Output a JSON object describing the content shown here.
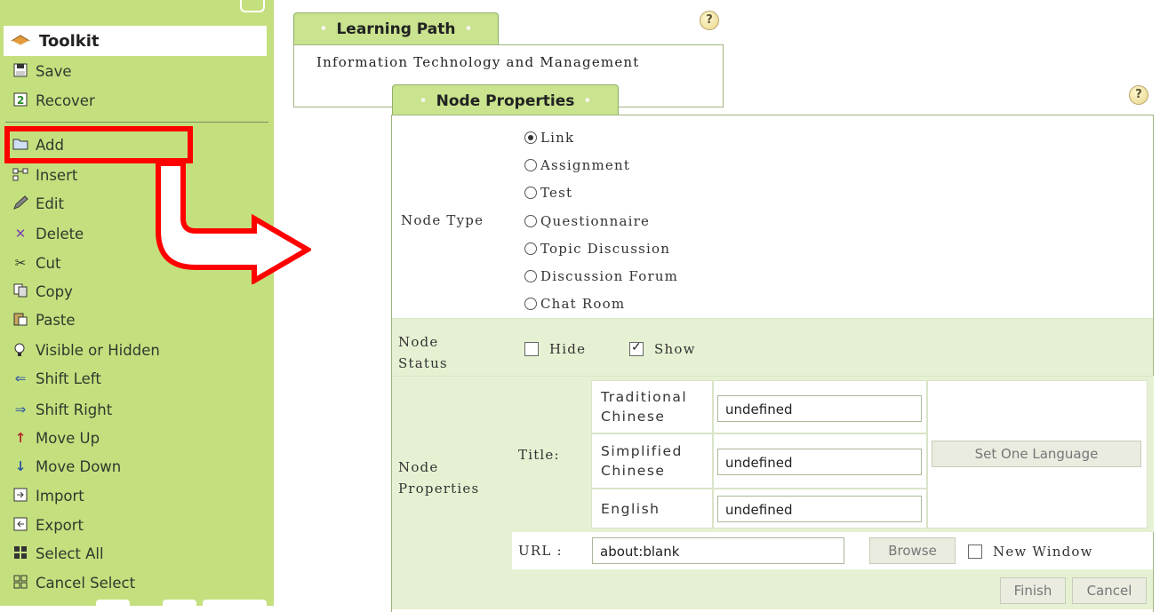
{
  "sidebar": {
    "title": "Toolkit",
    "items": [
      {
        "label": "Save",
        "icon": "floppy-disk-icon"
      },
      {
        "label": "Recover",
        "icon": "recover-icon"
      },
      {
        "label": "Add",
        "icon": "folder-icon"
      },
      {
        "label": "Insert",
        "icon": "insert-icon"
      },
      {
        "label": "Edit",
        "icon": "pencil-icon"
      },
      {
        "label": "Delete",
        "icon": "delete-x-icon"
      },
      {
        "label": "Cut",
        "icon": "scissors-icon"
      },
      {
        "label": "Copy",
        "icon": "copy-icon"
      },
      {
        "label": "Paste",
        "icon": "paste-icon"
      },
      {
        "label": "Visible or Hidden",
        "icon": "lightbulb-icon"
      },
      {
        "label": "Shift Left",
        "icon": "arrow-left-icon"
      },
      {
        "label": "Shift Right",
        "icon": "arrow-right-icon"
      },
      {
        "label": "Move Up",
        "icon": "arrow-up-icon"
      },
      {
        "label": "Move Down",
        "icon": "arrow-down-icon"
      },
      {
        "label": "Import",
        "icon": "import-icon"
      },
      {
        "label": "Export",
        "icon": "export-icon"
      },
      {
        "label": "Select All",
        "icon": "select-all-icon"
      },
      {
        "label": "Cancel Select",
        "icon": "cancel-select-icon"
      }
    ]
  },
  "learning_path": {
    "tab_label": "Learning Path",
    "course_name": "Information Technology and Management"
  },
  "node_properties": {
    "tab_label": "Node Properties",
    "node_type_label": "Node Type",
    "node_types": [
      "Link",
      "Assignment",
      "Test",
      "Questionnaire",
      "Topic Discussion",
      "Discussion Forum",
      "Chat Room"
    ],
    "selected_type": "Link",
    "status_label_1": "Node",
    "status_label_2": "Status",
    "status_hide": "Hide",
    "status_show": "Show",
    "status_show_checked": true,
    "status_hide_checked": false,
    "props_label_1": "Node",
    "props_label_2": "Properties",
    "title_label": "Title:",
    "lang_traditional_1": "Traditional",
    "lang_traditional_2": "Chinese",
    "lang_simplified_1": "Simplified",
    "lang_simplified_2": "Chinese",
    "lang_english": "English",
    "title_traditional_value": "undefined",
    "title_simplified_value": "undefined",
    "title_english_value": "undefined",
    "set_one_language": "Set One Language",
    "url_label": "URL :",
    "url_value": "about:blank",
    "browse": "Browse",
    "new_window": "New Window",
    "finish": "Finish",
    "cancel": "Cancel"
  },
  "help_symbol": "?",
  "colors": {
    "sidebar_bg": "#c4e07e",
    "highlight": "#ff0000",
    "row_bg": "#e6f1d3"
  }
}
